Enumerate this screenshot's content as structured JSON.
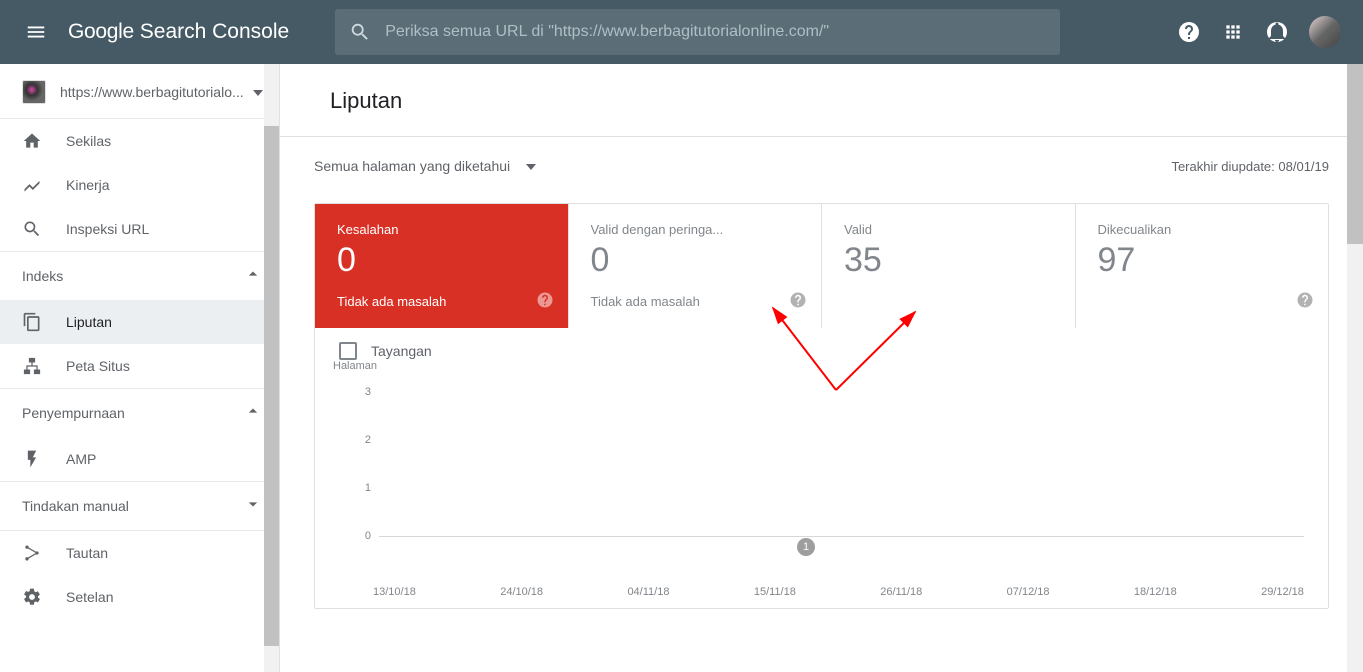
{
  "header": {
    "logo_google": "Google",
    "logo_rest": " Search Console",
    "search_placeholder": "Periksa semua URL di \"https://www.berbagitutorialonline.com/\""
  },
  "sidebar": {
    "property": "https://www.berbagitutorialo...",
    "items": {
      "overview": "Sekilas",
      "performance": "Kinerja",
      "url_inspect": "Inspeksi URL"
    },
    "groups": {
      "index": "Indeks",
      "enhancements": "Penyempurnaan",
      "manual": "Tindakan manual"
    },
    "index_items": {
      "coverage": "Liputan",
      "sitemaps": "Peta Situs"
    },
    "enh_items": {
      "amp": "AMP"
    },
    "footer_items": {
      "links": "Tautan",
      "settings": "Setelan"
    }
  },
  "page": {
    "title": "Liputan",
    "filter": "Semua halaman yang diketahui",
    "updated": "Terakhir diupdate: 08/01/19"
  },
  "cards": {
    "error": {
      "title": "Kesalahan",
      "value": "0",
      "sub": "Tidak ada masalah"
    },
    "warning": {
      "title": "Valid dengan peringa...",
      "value": "0",
      "sub": "Tidak ada masalah"
    },
    "valid": {
      "title": "Valid",
      "value": "35",
      "sub": ""
    },
    "excluded": {
      "title": "Dikecualikan",
      "value": "97",
      "sub": ""
    }
  },
  "legend": {
    "impressions": "Tayangan"
  },
  "chart_data": {
    "type": "line",
    "title": "",
    "ylabel": "Halaman",
    "yticks": [
      "3",
      "2",
      "1",
      "0"
    ],
    "ylim": [
      0,
      3
    ],
    "x": [
      "13/10/18",
      "24/10/18",
      "04/11/18",
      "15/11/18",
      "26/11/18",
      "07/12/18",
      "18/12/18",
      "29/12/18"
    ],
    "series": [
      {
        "name": "Kesalahan",
        "values": [
          0,
          0,
          0,
          0,
          0,
          0,
          0,
          0
        ]
      }
    ],
    "annotations": [
      {
        "x": "26/11/18",
        "label": "1"
      }
    ]
  }
}
